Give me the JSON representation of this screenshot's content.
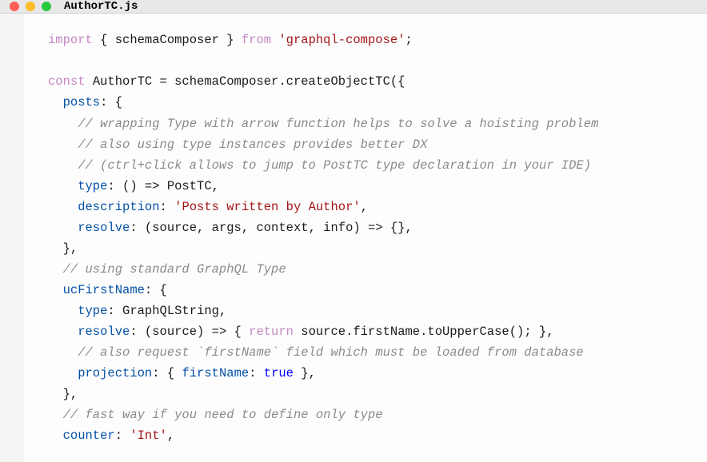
{
  "title": "AuthorTC.js",
  "code": {
    "l1_kw1": "import",
    "l1_txt1": " { schemaComposer } ",
    "l1_kw2": "from",
    "l1_str": " 'graphql-compose'",
    "l1_end": ";",
    "l3_kw": "const",
    "l3_txt": " AuthorTC = schemaComposer.createObjectTC({",
    "l4_prop": "  posts",
    "l4_txt": ": {",
    "l5_cmt": "    // wrapping Type with arrow function helps to solve a hoisting problem",
    "l6_cmt": "    // also using type instances provides better DX",
    "l7_cmt": "    // (ctrl+click allows to jump to PostTC type declaration in your IDE)",
    "l8_prop": "    type",
    "l8_txt": ": () => PostTC,",
    "l9_prop": "    description",
    "l9_txt": ": ",
    "l9_str": "'Posts written by Author'",
    "l9_end": ",",
    "l10_prop": "    resolve",
    "l10_txt": ": (source, args, context, info) => {},",
    "l11_txt": "  },",
    "l12_cmt": "  // using standard GraphQL Type",
    "l13_prop": "  ucFirstName",
    "l13_txt": ": {",
    "l14_prop": "    type",
    "l14_txt": ": GraphQLString,",
    "l15_prop": "    resolve",
    "l15_txt1": ": (source) => { ",
    "l15_kw": "return",
    "l15_txt2": " source.firstName.toUpperCase(); },",
    "l16_cmt": "    // also request `firstName` field which must be loaded from database",
    "l17_prop1": "    projection",
    "l17_txt1": ": { ",
    "l17_prop2": "firstName",
    "l17_txt2": ": ",
    "l17_bool": "true",
    "l17_txt3": " },",
    "l18_txt": "  },",
    "l19_cmt": "  // fast way if you need to define only type",
    "l20_prop": "  counter",
    "l20_txt": ": ",
    "l20_str": "'Int'",
    "l20_end": ","
  }
}
